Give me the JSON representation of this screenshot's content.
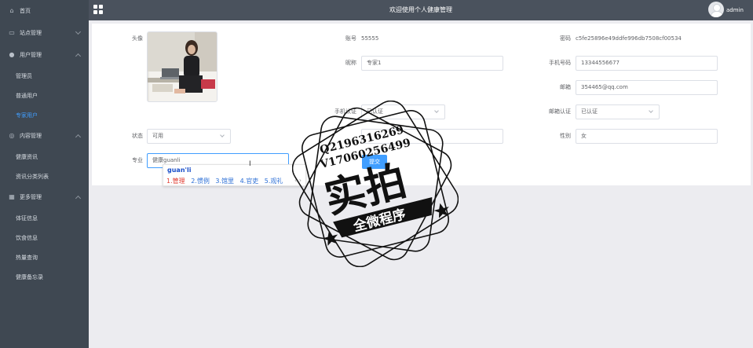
{
  "header": {
    "title": "欢迎使用个人健康管理",
    "user_name": "admin"
  },
  "sidebar": {
    "items": [
      {
        "label": "首页",
        "icon": "home-icon"
      },
      {
        "label": "站点管理",
        "icon": "monitor-icon"
      },
      {
        "label": "用户管理",
        "icon": "user-icon"
      },
      {
        "label": "管理员"
      },
      {
        "label": "普通用户"
      },
      {
        "label": "专家用户"
      },
      {
        "label": "内容管理",
        "icon": "content-icon"
      },
      {
        "label": "健康资讯"
      },
      {
        "label": "资讯分类列表"
      },
      {
        "label": "更多管理",
        "icon": "grid-icon"
      },
      {
        "label": "体征信息"
      },
      {
        "label": "饮食信息"
      },
      {
        "label": "热量查询"
      },
      {
        "label": "健康备忘录"
      }
    ],
    "active_color": "#409eff"
  },
  "form": {
    "avatar_label": "头像",
    "account_label": "账号",
    "account_value": "55555",
    "password_label": "密码",
    "password_value": "c5fe25896e49ddfe996db7508cf00534",
    "nickname_label": "昵称",
    "nickname_value": "专家1",
    "phone_label": "手机号码",
    "phone_value": "13344556677",
    "email_label": "邮箱",
    "email_value": "354465@qq.com",
    "phone_verify_label": "手机认证",
    "phone_verify_value": "已认证",
    "email_verify_label": "邮箱认证",
    "email_verify_value": "已认证",
    "status_label": "状态",
    "status_value": "可用",
    "gender_label": "性别",
    "gender_value": "女",
    "major_label": "专业",
    "major_value": "健康guanli",
    "save_label": "提交"
  },
  "ime": {
    "pinyin": "guan'li",
    "candidates": [
      "1.管理",
      "2.惯例",
      "3.馆里",
      "4.官吏",
      "5.观礼"
    ],
    "nav": "‹ ›"
  },
  "watermark": {
    "line1": "Q2196316269",
    "line2": "V17060256499",
    "main": "实拍",
    "sub": "全微程序"
  },
  "colors": {
    "sidebar_bg": "#3f4852",
    "header_bg": "#4a525d",
    "primary": "#409eff"
  }
}
